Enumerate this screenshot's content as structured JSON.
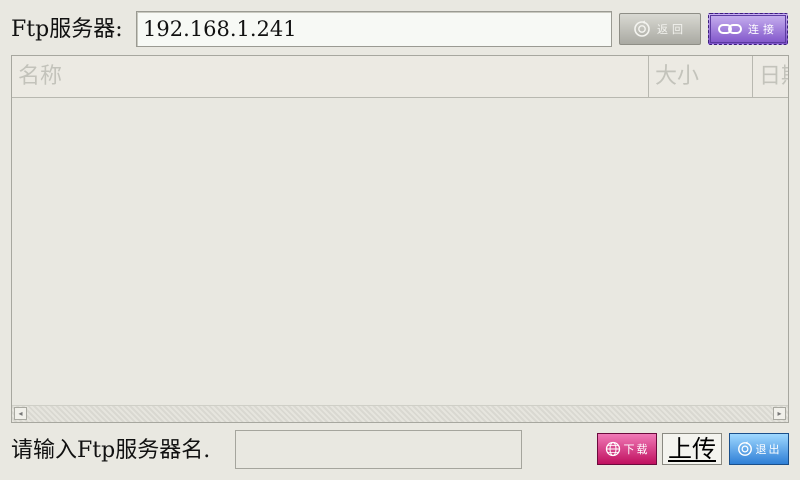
{
  "server": {
    "label": "Ftp服务器:",
    "value": "192.168.1.241"
  },
  "toolbar": {
    "back_label": "返回",
    "connect_label": "连接"
  },
  "file_list": {
    "columns": [
      "名称",
      "大小",
      "日期"
    ]
  },
  "bottom": {
    "prompt_label": "请输入Ftp服务器名.",
    "name_value": "",
    "download_label": "下载",
    "upload_label": "上传",
    "exit_label": "退出"
  },
  "icons": {
    "back": "refresh-arrow-icon",
    "connect": "chain-link-icon",
    "download": "globe-icon",
    "exit": "refresh-arrow-icon",
    "scroll_left": "triangle-left-icon",
    "scroll_right": "triangle-right-icon"
  },
  "colors": {
    "background": "#e9e8e1",
    "connect_accent": "#7e52c9",
    "download_accent": "#c0105f",
    "exit_accent": "#2f7fd6"
  }
}
